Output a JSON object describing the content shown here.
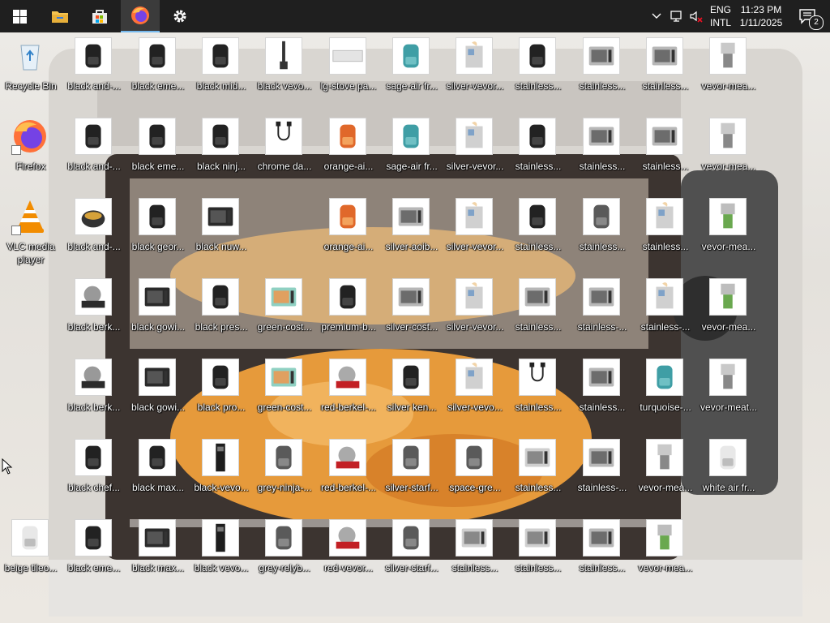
{
  "taskbar": {
    "lang": [
      "ENG",
      "INTL"
    ],
    "time": "11:23 PM",
    "date": "1/11/2025",
    "notification_count": "2",
    "pinned": [
      {
        "name": "start-button",
        "icon": "windows-logo-icon"
      },
      {
        "name": "file-explorer-button",
        "icon": "folder-icon"
      },
      {
        "name": "microsoft-store-button",
        "icon": "store-icon"
      },
      {
        "name": "firefox-taskbar-button",
        "icon": "firefox-icon",
        "active": true
      },
      {
        "name": "settings-taskbar-button",
        "icon": "gear-icon"
      }
    ],
    "tray": [
      "chevron-up-icon",
      "network-icon",
      "volume-muted-icon"
    ]
  },
  "desktop": {
    "system_icons": [
      {
        "label": "Recycle Bin",
        "icon": "recycle-bin-icon"
      },
      {
        "label": "Firefox",
        "icon": "firefox-icon"
      },
      {
        "label": "VLC media player",
        "icon": "vlc-icon"
      },
      {
        "label": "",
        "icon": ""
      },
      {
        "label": "",
        "icon": ""
      },
      {
        "label": "",
        "icon": ""
      },
      {
        "label": "beige tileo...",
        "icon": "air-fryer-icon"
      }
    ],
    "columns": [
      [
        "black and-...",
        "black and-...",
        "black and-...",
        "black berk...",
        "black berk...",
        "black chef...",
        "black eme..."
      ],
      [
        "black eme...",
        "black eme...",
        "black geor...",
        "black gowi...",
        "black gowi...",
        "black max...",
        "black max..."
      ],
      [
        "black mid...",
        "black ninj...",
        "black nuw...",
        "black pres...",
        "black pro...",
        "black-vevo...",
        "black vevo..."
      ],
      [
        "black vevo...",
        "chrome da...",
        "",
        "green-cost...",
        "green-cost...",
        "grey-ninja-...",
        "grey-relyb..."
      ],
      [
        "lg-stove pa...",
        "orange-ai...",
        "orange-ai...",
        "premium-b...",
        "red-berkel-...",
        "red-berkel-...",
        "red-vevor..."
      ],
      [
        "sage-air fr...",
        "sage-air fr...",
        "silver-aoib...",
        "silver-cost...",
        "silver ken...",
        "silver-starf...",
        "silver-starf..."
      ],
      [
        "silver-vevor...",
        "silver-vevor...",
        "silver-vevor...",
        "silver-vevor...",
        "silver-vevo...",
        "space-gre...",
        "stainless..."
      ],
      [
        "stainless...",
        "stainless...",
        "stainless...",
        "stainless...",
        "stainless...",
        "stainless...",
        "stainless..."
      ],
      [
        "stainless...",
        "stainless...",
        "stainless...",
        "stainless-...",
        "stainless...",
        "stainless-...",
        "stainless..."
      ],
      [
        "stainless...",
        "stainless...",
        "stainless...",
        "stainless-...",
        "turquoise-...",
        "vevor-mea...",
        "vevor-mea..."
      ],
      [
        "vevor-mea...",
        "vevor-mea...",
        "vevor-mea...",
        "vevor-mea...",
        "vevor-meat...",
        "white air fr...",
        ""
      ]
    ],
    "thumb_kinds": [
      [
        "fryer-black",
        "fryer-black",
        "pot-black",
        "slicer",
        "slicer",
        "fryer-black",
        "fryer-black"
      ],
      [
        "fryer-black",
        "fryer-black",
        "fryer-black",
        "oven-black",
        "oven-black",
        "fryer-black",
        "oven-black"
      ],
      [
        "fryer-black",
        "fryer-black",
        "oven-black",
        "fryer-black",
        "fryer-black",
        "tower-black",
        "tower-black"
      ],
      [
        "blender",
        "cable",
        "",
        "oven-green",
        "oven-green",
        "fryer-grey",
        "fryer-grey"
      ],
      [
        "tray",
        "fryer-orange",
        "fryer-orange",
        "fryer-black",
        "slicer-red",
        "slicer-red",
        "slicer-red"
      ],
      [
        "fryer-teal",
        "fryer-teal",
        "oven-silver",
        "oven-silver",
        "fryer-black",
        "fryer-grey",
        "fryer-grey"
      ],
      [
        "machine",
        "machine",
        "machine",
        "machine",
        "machine",
        "fryer-grey",
        "oven-small"
      ],
      [
        "fryer-black",
        "fryer-black",
        "fryer-black",
        "oven-silver",
        "cable",
        "oven-small",
        "oven-small"
      ],
      [
        "oven-silver",
        "oven-silver",
        "fryer-grey",
        "oven-silver",
        "oven-silver",
        "oven-silver",
        "oven-silver"
      ],
      [
        "oven-silver",
        "oven-silver",
        "machine",
        "machine",
        "fryer-teal",
        "mixer",
        "mixer-green"
      ],
      [
        "mixer",
        "mixer",
        "mixer-green",
        "mixer-green",
        "mixer",
        "fryer-white",
        ""
      ]
    ]
  },
  "colors": {
    "taskbar": "#1f1f1f",
    "accent": "#76b9ed",
    "label_text": "#ffffff"
  }
}
